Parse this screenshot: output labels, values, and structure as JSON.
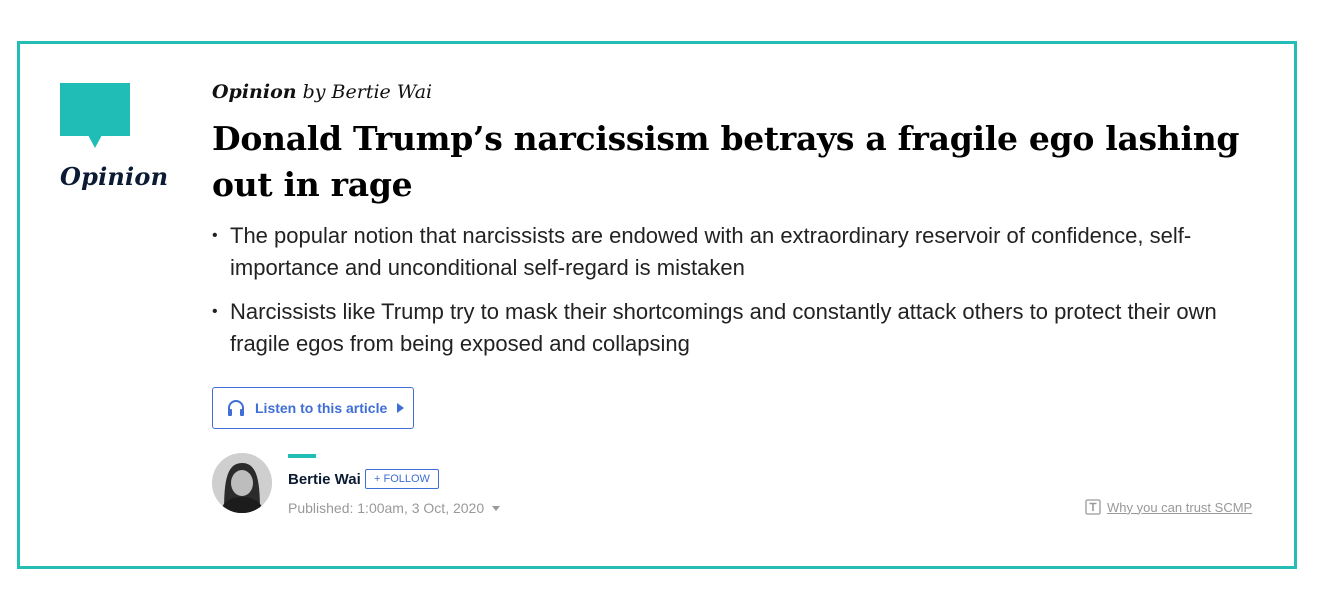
{
  "badge": {
    "label": "Opinion",
    "color": "#1fbdb5"
  },
  "kicker": {
    "section": "Opinion",
    "byline": "by Bertie Wai"
  },
  "headline": "Donald Trump’s narcissism betrays a fragile ego lashing out in rage",
  "bullets": [
    "The popular notion that narcissists are endowed with an extraordinary reservoir of confidence, self-importance and unconditional self-regard is mistaken",
    "Narcissists like Trump try to mask their shortcomings and constantly attack others to protect their own fragile egos from being exposed and collapsing"
  ],
  "listen": {
    "label": "Listen to this article",
    "icon": "headphones-icon",
    "play_icon": "play-icon"
  },
  "author": {
    "name": "Bertie Wai",
    "follow_label": "+ FOLLOW",
    "published": "Published: 1:00am, 3 Oct, 2020"
  },
  "trust": {
    "label": "Why you can trust SCMP",
    "icon": "trust-icon"
  },
  "colors": {
    "accent": "#1fbdb5",
    "link": "#3f6fd6"
  }
}
